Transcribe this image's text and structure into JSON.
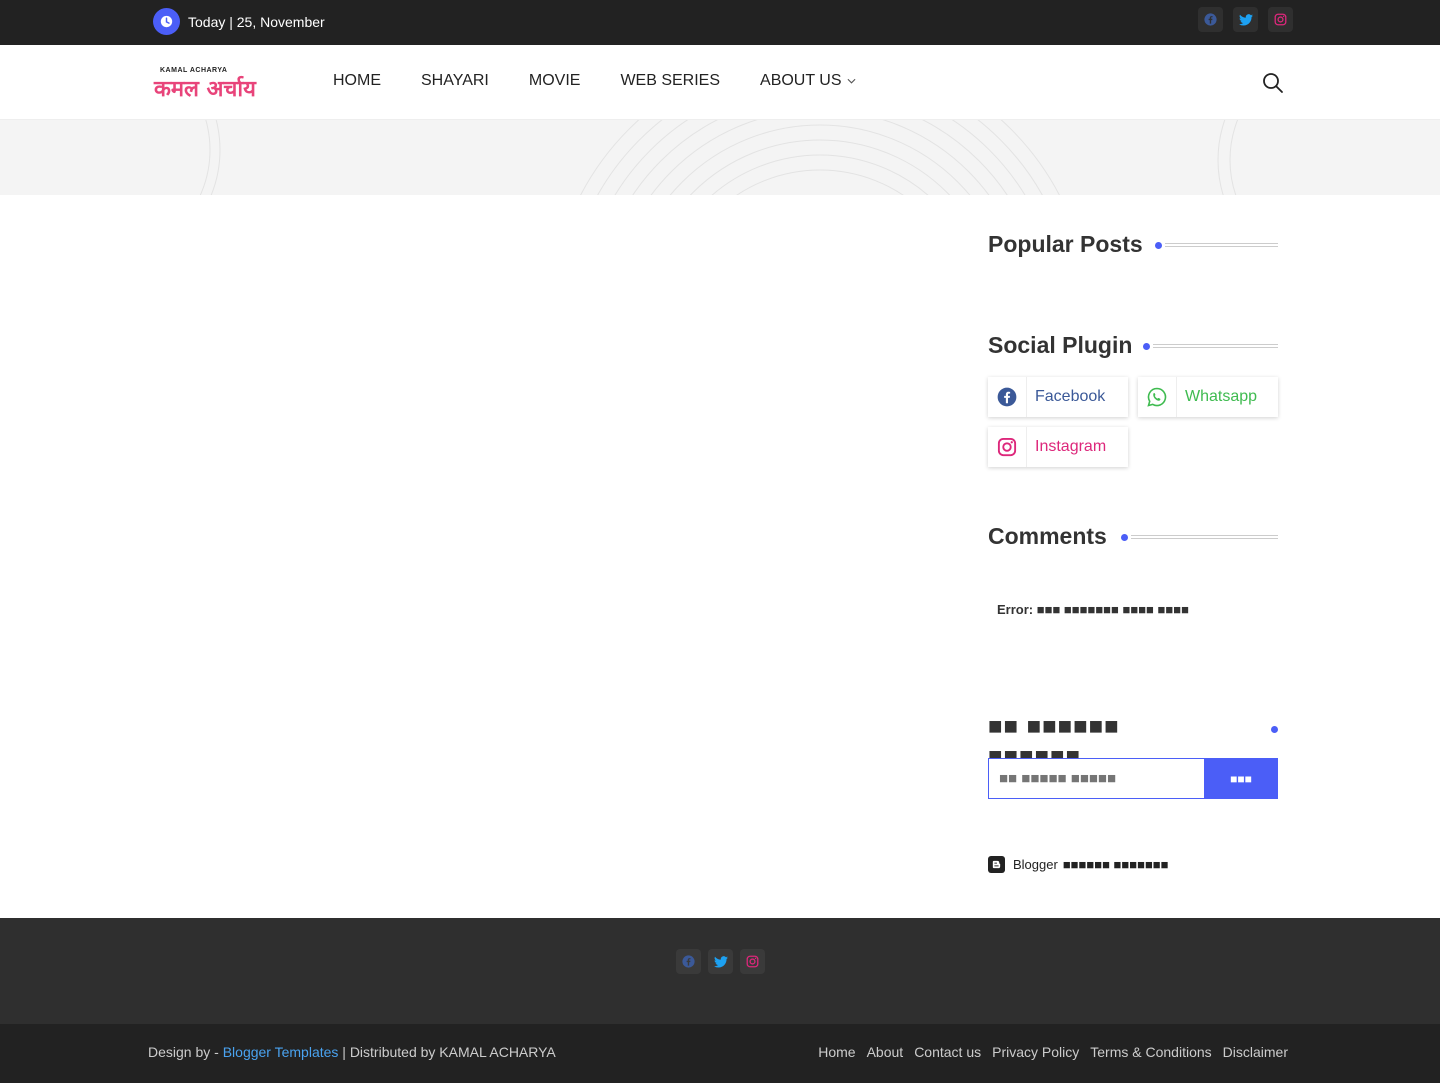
{
  "topbar": {
    "date_text": "Today | 25, November",
    "social": [
      "facebook-icon",
      "twitter-icon",
      "instagram-icon"
    ]
  },
  "header": {
    "logo_small": "KAMAL ACHARYA",
    "logo_big": "कमल अर्चाय",
    "nav": [
      {
        "label": "HOME"
      },
      {
        "label": "SHAYARI"
      },
      {
        "label": "MOVIE"
      },
      {
        "label": "WEB SERIES"
      },
      {
        "label": "ABOUT US",
        "has_dropdown": true
      }
    ]
  },
  "sidebar": {
    "popular_title": "Popular Posts",
    "social_title": "Social Plugin",
    "social_buttons": [
      {
        "label": "Facebook",
        "icon": "facebook-icon",
        "color": "#3b5998"
      },
      {
        "label": "Whatsapp",
        "icon": "whatsapp-icon",
        "color": "#3fbb50"
      },
      {
        "label": "Instagram",
        "icon": "instagram-icon",
        "color": "#dd277b"
      }
    ],
    "comments_title": "Comments",
    "error_prefix": "Error:",
    "error_text": "■■■ ■■■■■■■ ■■■■ ■■■■",
    "follow_title": "■■ ■■■■■■ ■■■■■■",
    "follow_placeholder": "■■ ■■■■■ ■■■■■",
    "follow_button": "■■■",
    "blogger_label": "Blogger",
    "blogger_text": "■■■■■■ ■■■■■■■"
  },
  "footer": {
    "social": [
      "facebook-icon",
      "twitter-icon",
      "instagram-icon"
    ],
    "credit_prefix": "Design by -",
    "credit_link": "Blogger Templates",
    "credit_suffix": "| Distributed by KAMAL ACHARYA",
    "links": [
      "Home",
      "About",
      "Contact us",
      "Privacy Policy",
      "Terms & Conditions",
      "Disclaimer"
    ]
  },
  "colors": {
    "accent": "#4b5ef7",
    "logo": "#e8447a",
    "facebook": "#3b5998",
    "whatsapp": "#3fbb50",
    "instagram": "#dd277b",
    "twitter": "#1da1f2"
  }
}
